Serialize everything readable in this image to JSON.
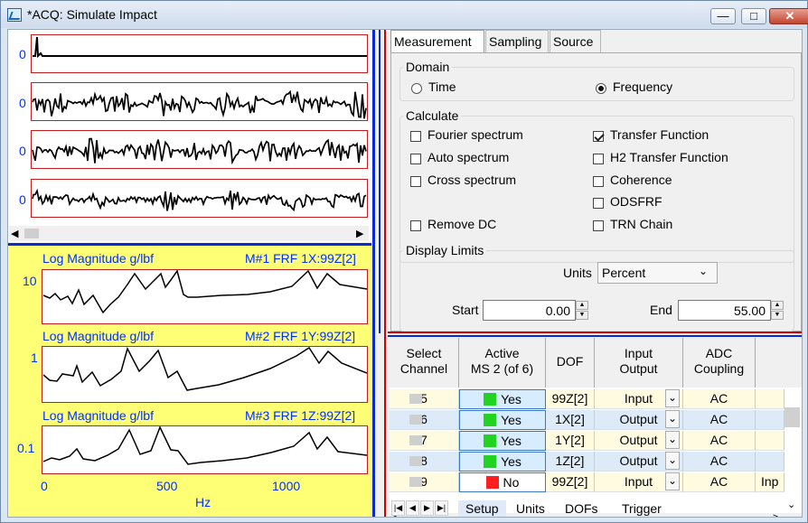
{
  "window": {
    "title": "*ACQ: Simulate Impact",
    "min": "—",
    "restore": "□",
    "close": "✕"
  },
  "time_panel": {
    "zero_labels": [
      "0",
      "0",
      "0",
      "0"
    ]
  },
  "frf_panel": {
    "plots": [
      {
        "type_label": "Log Magnitude g/lbf",
        "trace_label": "M#1 FRF 1X:99Z[2]",
        "y_tick": "10"
      },
      {
        "type_label": "Log Magnitude g/lbf",
        "trace_label": "M#2 FRF 1Y:99Z[2]",
        "y_tick": "1"
      },
      {
        "type_label": "Log Magnitude g/lbf",
        "trace_label": "M#3 FRF 1Z:99Z[2]",
        "y_tick": "0.1"
      }
    ],
    "x_ticks": [
      "0",
      "500",
      "1000"
    ],
    "x_label": "Hz"
  },
  "tabs": {
    "measurement": "Measurement",
    "sampling": "Sampling",
    "source": "Source"
  },
  "domain": {
    "label": "Domain",
    "time": "Time",
    "frequency": "Frequency"
  },
  "calculate": {
    "label": "Calculate",
    "fourier": "Fourier spectrum",
    "auto": "Auto spectrum",
    "cross": "Cross spectrum",
    "remove_dc": "Remove DC",
    "transfer": "Transfer Function",
    "h2": "H2 Transfer Function",
    "coherence": "Coherence",
    "odsfrf": "ODSFRF",
    "trn": "TRN Chain"
  },
  "display_limits": {
    "label": "Display Limits",
    "units_label": "Units",
    "units_value": "Percent",
    "start_label": "Start",
    "start_value": "0.00",
    "end_label": "End",
    "end_value": "55.00"
  },
  "grid": {
    "headers": {
      "select": "Select\nChannel",
      "active": "Active\nMS 2 (of 6)",
      "dof": "DOF",
      "io": "Input\nOutput",
      "adc": "ADC\nCoupling"
    },
    "rows": [
      {
        "channel": "5",
        "active": "Yes",
        "dof": "99Z[2]",
        "io": "Input",
        "adc": "AC",
        "extra": ""
      },
      {
        "channel": "6",
        "active": "Yes",
        "dof": "1X[2]",
        "io": "Output",
        "adc": "AC",
        "extra": ""
      },
      {
        "channel": "7",
        "active": "Yes",
        "dof": "1Y[2]",
        "io": "Output",
        "adc": "AC",
        "extra": ""
      },
      {
        "channel": "8",
        "active": "Yes",
        "dof": "1Z[2]",
        "io": "Output",
        "adc": "AC",
        "extra": ""
      },
      {
        "channel": "9",
        "active": "No",
        "dof": "99Z[2]",
        "io": "Input",
        "adc": "AC",
        "extra": "Inp"
      }
    ]
  },
  "sheet_tabs": {
    "setup": "Setup",
    "units": "Units",
    "dofs": "DOFs",
    "trigger": "Trigger"
  },
  "colors": {
    "blue": "#0829d8",
    "red": "#d20000",
    "yellow": "#ffff75",
    "plot_border": "#c41d1d",
    "green": "#22d322",
    "stop_red": "#ff1f1f"
  },
  "icons": [
    "app-icon",
    "minimize-icon",
    "restore-icon",
    "close-icon",
    "dropdown-arrow-icon",
    "scroll-left-icon",
    "scroll-right-icon",
    "scroll-up-icon",
    "scroll-down-icon"
  ]
}
